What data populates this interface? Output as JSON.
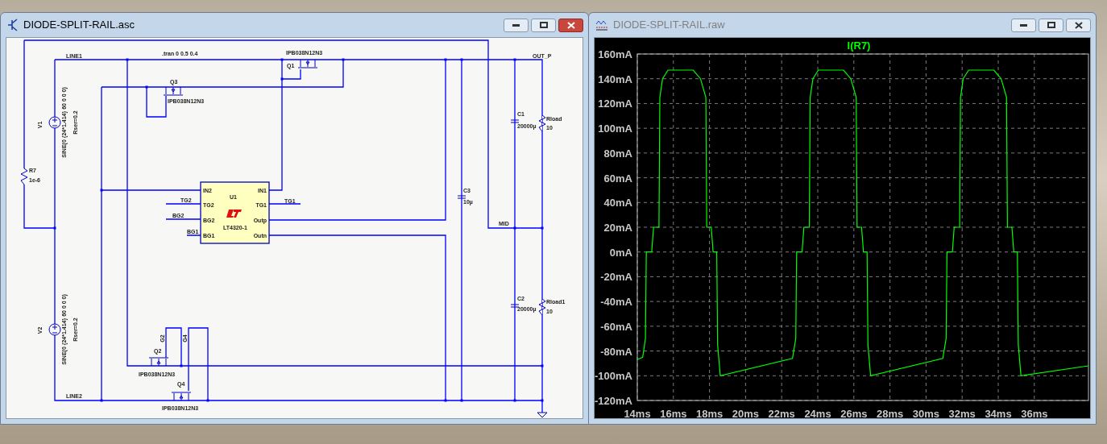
{
  "schematic_window": {
    "title": "DIODE-SPLIT-RAIL.asc",
    "active": true,
    "labels": [
      ".tran 0 0.5 0.4",
      "LINE1",
      "IPB038N12N3",
      "Q1",
      "Q3",
      "IPB038N12N3",
      "OUT_P",
      "C1",
      "20000µ",
      "Rload",
      "10",
      "V1",
      "SINE(0 {24*1.414} 60 0 0 0)",
      "Rser=0.2",
      "R7",
      "1e-6",
      "TG2",
      "BG2",
      "BG1",
      "TG1",
      "C3",
      "10µ",
      "MID",
      "C2",
      "20000µ",
      "Rload1",
      "10",
      "V2",
      "SINE(0 {24*1.414} 60 0 0 0)",
      "Rser=0.2",
      "G2",
      "G4",
      "Q2",
      "IPB038N12N3",
      "Q4",
      "IPB038N12N3",
      "LINE2"
    ],
    "ic": {
      "name": "U1",
      "part": "LT4320-1",
      "pins": [
        "IN2",
        "TG2",
        "BG2",
        "BG1",
        "IN1",
        "TG1",
        "Outp",
        "Outn"
      ]
    }
  },
  "waveform_window": {
    "title": "DIODE-SPLIT-RAIL.raw",
    "active": false,
    "chart_data": {
      "type": "line",
      "title": "I(R7)",
      "grid": true,
      "x": [
        14,
        14.3,
        14.45,
        14.5,
        14.8,
        14.9,
        15.2,
        15.25,
        15.4,
        15.7,
        17.1,
        17.5,
        17.8,
        17.85,
        18.1,
        18.2,
        18.4,
        18.45,
        18.6,
        22.6,
        22.78,
        22.83,
        23.13,
        23.23,
        23.53,
        23.58,
        23.73,
        24.03,
        25.43,
        25.83,
        26.13,
        26.18,
        26.43,
        26.53,
        26.73,
        26.78,
        26.93,
        30.93,
        31.11,
        31.16,
        31.46,
        31.56,
        31.86,
        31.91,
        32.06,
        32.36,
        33.76,
        34.16,
        34.46,
        34.51,
        34.76,
        34.86,
        35.06,
        35.11,
        35.26,
        39
      ],
      "values": [
        -87,
        -85,
        -70,
        0,
        0,
        20,
        20,
        125,
        140,
        147,
        147,
        140,
        125,
        20,
        20,
        0,
        0,
        -75,
        -100,
        -86,
        -70,
        0,
        0,
        20,
        20,
        125,
        140,
        147,
        147,
        140,
        125,
        20,
        20,
        0,
        0,
        -75,
        -100,
        -86,
        -70,
        0,
        0,
        20,
        20,
        125,
        140,
        147,
        147,
        140,
        125,
        20,
        20,
        0,
        0,
        -75,
        -100,
        -92
      ],
      "xlim": [
        14,
        39
      ],
      "ylim": [
        -120,
        160
      ],
      "xticks": [
        {
          "value": 14,
          "label": "14ms"
        },
        {
          "value": 16,
          "label": "16ms"
        },
        {
          "value": 18,
          "label": "18ms"
        },
        {
          "value": 20,
          "label": "20ms"
        },
        {
          "value": 22,
          "label": "22ms"
        },
        {
          "value": 24,
          "label": "24ms"
        },
        {
          "value": 26,
          "label": "26ms"
        },
        {
          "value": 28,
          "label": "28ms"
        },
        {
          "value": 30,
          "label": "30ms"
        },
        {
          "value": 32,
          "label": "32ms"
        },
        {
          "value": 34,
          "label": "34ms"
        },
        {
          "value": 36,
          "label": "36ms"
        }
      ],
      "yticks": [
        {
          "value": 160,
          "label": "160mA"
        },
        {
          "value": 140,
          "label": "140mA"
        },
        {
          "value": 120,
          "label": "120mA"
        },
        {
          "value": 100,
          "label": "100mA"
        },
        {
          "value": 80,
          "label": "80mA"
        },
        {
          "value": 60,
          "label": "60mA"
        },
        {
          "value": 40,
          "label": "40mA"
        },
        {
          "value": 20,
          "label": "20mA"
        },
        {
          "value": 0,
          "label": "0mA"
        },
        {
          "value": -20,
          "label": "-20mA"
        },
        {
          "value": -40,
          "label": "-40mA"
        },
        {
          "value": -60,
          "label": "-60mA"
        },
        {
          "value": -80,
          "label": "-80mA"
        },
        {
          "value": -100,
          "label": "-100mA"
        },
        {
          "value": -120,
          "label": "-120mA"
        }
      ]
    }
  }
}
